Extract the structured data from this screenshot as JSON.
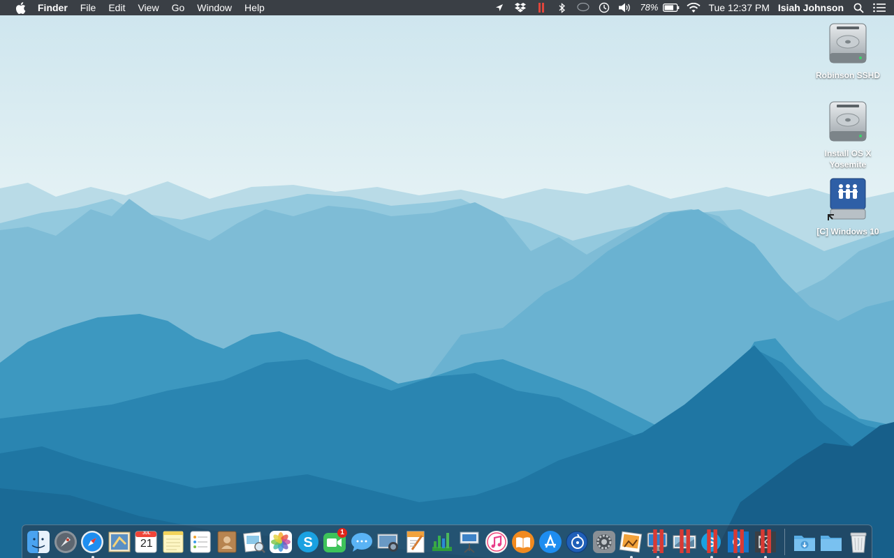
{
  "menubar": {
    "apple_icon": "apple-icon",
    "app_name": "Finder",
    "menus": [
      "File",
      "Edit",
      "View",
      "Go",
      "Window",
      "Help"
    ],
    "status": {
      "battery_percent": "78%",
      "clock": "Tue 12:37 PM",
      "user": "Isiah Johnson"
    }
  },
  "desktop": {
    "items": [
      {
        "label": "Robinson SSHD",
        "icon": "hard-drive-icon"
      },
      {
        "label": "Install OS X Yosemite",
        "icon": "hard-drive-icon"
      },
      {
        "label": "[C] Windows 10",
        "icon": "network-share-icon"
      }
    ]
  },
  "dock": {
    "calendar": {
      "month": "JUL",
      "day": "21"
    },
    "facetime_badge": "1",
    "apps": [
      "finder",
      "launchpad",
      "safari",
      "mail",
      "calendar",
      "notes",
      "reminders",
      "contacts",
      "preview",
      "photos",
      "skype",
      "facetime",
      "messages",
      "image-capture",
      "pages",
      "numbers",
      "keynote",
      "itunes",
      "ibooks",
      "app-store",
      "xcode-instruments",
      "system-preferences",
      "iphoto",
      "screen-sharing",
      "photo-viewer",
      "skype-alt",
      "app-o",
      "app-x",
      "downloads-stack",
      "documents-stack",
      "trash"
    ]
  },
  "colors": {
    "menubar_bg": "#3a3f45",
    "wallpaper_top": "#cfe6ef",
    "wallpaper_bottom": "#17628e"
  }
}
